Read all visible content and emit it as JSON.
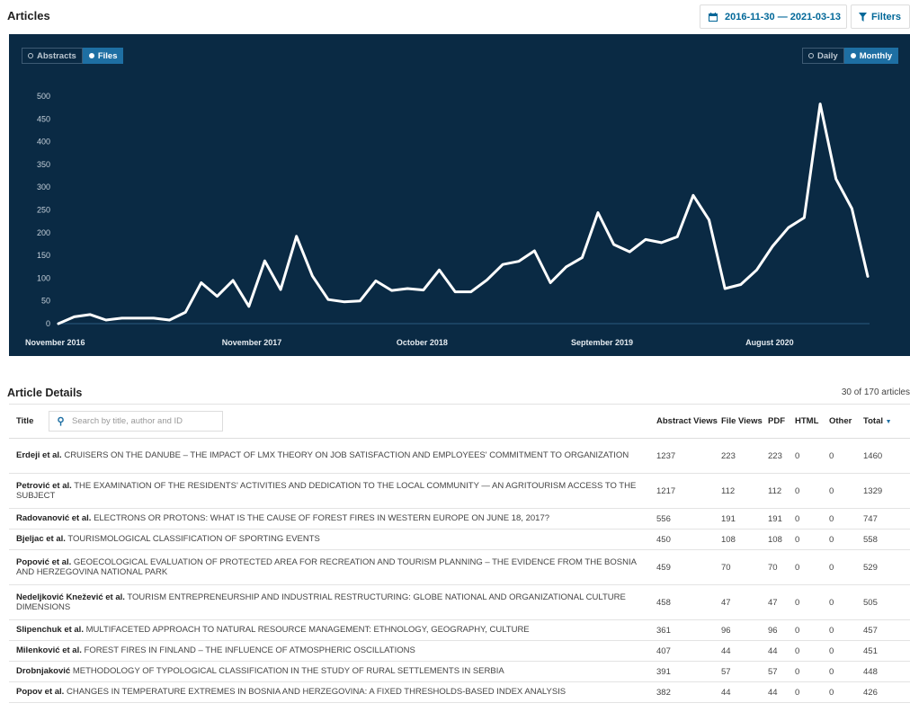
{
  "header": {
    "title": "Articles",
    "date_range": "2016-11-30 — 2021-03-13",
    "filters_label": "Filters",
    "calendar_icon": "calendar-icon",
    "filter_icon": "funnel-icon"
  },
  "chart_toggles": {
    "abstracts": "Abstracts",
    "files": "Files",
    "daily": "Daily",
    "monthly": "Monthly"
  },
  "colors": {
    "panel_bg": "#0a2a44",
    "line": "#ffffff",
    "accent": "#1e6fa3",
    "link": "#006798"
  },
  "chart_data": {
    "type": "line",
    "ylim": [
      0,
      500
    ],
    "y_ticks": [
      "0",
      "50",
      "100",
      "150",
      "200",
      "250",
      "300",
      "350",
      "400",
      "450",
      "500"
    ],
    "x_tick_labels": [
      "November 2016",
      "November 2017",
      "October 2018",
      "September 2019",
      "August 2020"
    ],
    "x_tick_index": [
      0,
      12,
      23,
      34,
      45
    ],
    "series": [
      {
        "values": [
          0,
          15,
          20,
          8,
          12,
          12,
          12,
          8,
          25,
          90,
          60,
          95,
          38,
          138,
          75,
          192,
          105,
          53,
          48,
          50,
          94,
          73,
          77,
          74,
          118,
          70,
          70,
          96,
          130,
          137,
          160,
          90,
          125,
          145,
          244,
          174,
          158,
          185,
          178,
          191,
          282,
          228,
          77,
          86,
          118,
          170,
          211,
          233,
          483,
          318,
          253,
          104
        ]
      }
    ]
  },
  "details": {
    "heading": "Article Details",
    "count": "30 of 170 articles",
    "columns": {
      "title": "Title",
      "abstract_views": "Abstract Views",
      "file_views": "File Views",
      "pdf": "PDF",
      "html": "HTML",
      "other": "Other",
      "total": "Total"
    },
    "search_placeholder": "Search by title, author and ID",
    "rows": [
      {
        "author": "Erdeji et al.",
        "title": "CRUISERS ON THE DANUBE – THE IMPACT OF LMX THEORY ON JOB SATISFACTION AND EMPLOYEES' COMMITMENT TO ORGANIZATION",
        "abstract": "1237",
        "file": "223",
        "pdf": "223",
        "html": "0",
        "other": "0",
        "total": "1460"
      },
      {
        "author": "Petrović et al.",
        "title": "THE EXAMINATION OF THE RESIDENTS' ACTIVITIES AND DEDICATION TO THE LOCAL COMMUNITY — AN AGRITOURISM ACCESS TO THE SUBJECT",
        "abstract": "1217",
        "file": "112",
        "pdf": "112",
        "html": "0",
        "other": "0",
        "total": "1329"
      },
      {
        "author": "Radovanović et al.",
        "title": "ELECTRONS OR PROTONS: WHAT IS THE CAUSE OF FOREST FIRES IN WESTERN EUROPE ON JUNE 18, 2017?",
        "abstract": "556",
        "file": "191",
        "pdf": "191",
        "html": "0",
        "other": "0",
        "total": "747"
      },
      {
        "author": "Bjeljac et al.",
        "title": "TOURISMOLOGICAL CLASSIFICATION OF SPORTING EVENTS",
        "abstract": "450",
        "file": "108",
        "pdf": "108",
        "html": "0",
        "other": "0",
        "total": "558"
      },
      {
        "author": "Popović et al.",
        "title": "GEOECOLOGICAL EVALUATION OF PROTECTED AREA FOR RECREATION AND TOURISM PLANNING – THE EVIDENCE FROM THE BOSNIA AND HERZEGOVINA NATIONAL PARK",
        "abstract": "459",
        "file": "70",
        "pdf": "70",
        "html": "0",
        "other": "0",
        "total": "529"
      },
      {
        "author": "Nedeljković Knežević et al.",
        "title": "TOURISM ENTREPRENEURSHIP AND INDUSTRIAL RESTRUCTURING: GLOBE NATIONAL AND ORGANIZATIONAL CULTURE DIMENSIONS",
        "abstract": "458",
        "file": "47",
        "pdf": "47",
        "html": "0",
        "other": "0",
        "total": "505"
      },
      {
        "author": "Slipenchuk et al.",
        "title": "MULTIFACETED APPROACH TO NATURAL RESOURCE MANAGEMENT: ETHNOLOGY, GEOGRAPHY, CULTURE",
        "abstract": "361",
        "file": "96",
        "pdf": "96",
        "html": "0",
        "other": "0",
        "total": "457"
      },
      {
        "author": "Milenković et al.",
        "title": "FOREST FIRES IN FINLAND – THE INFLUENCE OF ATMOSPHERIC OSCILLATIONS",
        "abstract": "407",
        "file": "44",
        "pdf": "44",
        "html": "0",
        "other": "0",
        "total": "451"
      },
      {
        "author": "Drobnjaković",
        "title": "METHODOLOGY OF TYPOLOGICAL CLASSIFICATION IN THE STUDY OF RURAL SETTLEMENTS IN SERBIA",
        "abstract": "391",
        "file": "57",
        "pdf": "57",
        "html": "0",
        "other": "0",
        "total": "448"
      },
      {
        "author": "Popov et al.",
        "title": "CHANGES IN TEMPERATURE EXTREMES IN BOSNIA AND HERZEGOVINA: A FIXED THRESHOLDS-BASED INDEX ANALYSIS",
        "abstract": "382",
        "file": "44",
        "pdf": "44",
        "html": "0",
        "other": "0",
        "total": "426"
      }
    ]
  }
}
